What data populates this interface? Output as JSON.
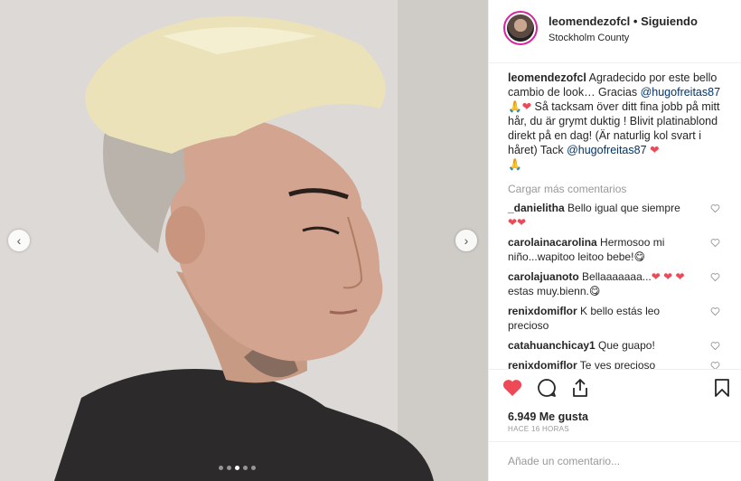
{
  "photo": {
    "alt_icon_prev": "chevron-left-icon",
    "alt_icon_next": "chevron-right-icon",
    "carousel_count": 5,
    "carousel_active_index": 2
  },
  "header": {
    "username": "leomendezofcl",
    "separator": "•",
    "follow_status": "Siguiendo",
    "location": "Stockholm County"
  },
  "caption": {
    "username": "leomendezofcl",
    "text_1": " Agradecido por este bello cambio de look… Gracias ",
    "mention_1": "@hugofreitas87",
    "emoji_1": "🙏",
    "heart_1": "❤",
    "text_2": " Så tacksam över ditt fina jobb på mitt hår, du är grymt duktig ! Blivit platinablond direkt på en dag! (Är naturlig kol svart i håret) Tack ",
    "mention_2": "@hugofreitas87",
    "heart_2": "❤",
    "emoji_2": "🙏"
  },
  "load_more": "Cargar más comentarios",
  "comments": [
    {
      "user": "_danielitha",
      "text": " Bello igual que siempre",
      "extra": "❤❤"
    },
    {
      "user": "carolainacarolina",
      "text": " Hermosoo mi niño...wapitoo leitoo bebe!",
      "extra": "😋"
    },
    {
      "user": "carolajuanoto",
      "text": " Bellaaaaaaa...",
      "extra": "❤ ❤ ❤",
      "text_after": " estas muy.bienn.",
      "extra_after": "😋"
    },
    {
      "user": "renixdomiflor",
      "text": " K bello estás leo precioso",
      "extra": ""
    },
    {
      "user": "catahuanchicay1",
      "text": " Que guapo!",
      "extra": ""
    },
    {
      "user": "renixdomiflor",
      "text": " Te ves precioso",
      "extra": ""
    }
  ],
  "actions": {
    "like_icon": "heart-filled-icon",
    "comment_icon": "comment-icon",
    "share_icon": "share-icon",
    "save_icon": "bookmark-icon"
  },
  "likes_text": "6.949 Me gusta",
  "time_ago": "HACE 16 HORAS",
  "add_comment_placeholder": "Añade un comentario...",
  "colors": {
    "heart": "#ed4956",
    "mention": "#003569",
    "muted": "#999999",
    "text": "#262626"
  }
}
